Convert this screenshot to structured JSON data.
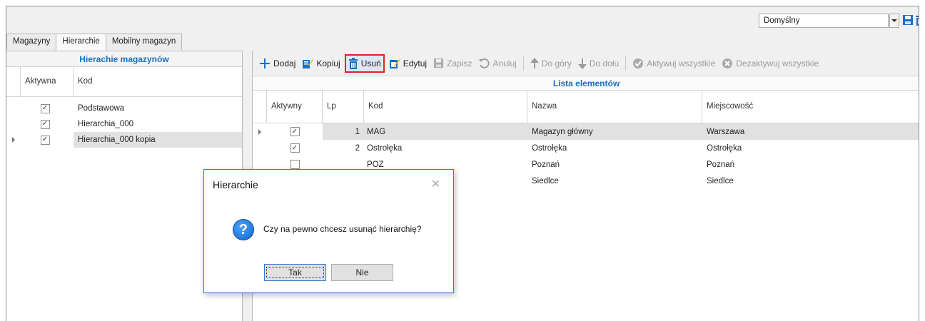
{
  "profile": {
    "selected": "Domyślny"
  },
  "tabs": [
    {
      "label": "Magazyny"
    },
    {
      "label": "Hierarchie"
    },
    {
      "label": "Mobilny magazyn"
    }
  ],
  "left_panel": {
    "title": "Hierachie magazynów",
    "columns": [
      "Aktywna",
      "Kod"
    ],
    "rows": [
      {
        "active": "✓",
        "code": "Podstawowa"
      },
      {
        "active": "✓",
        "code": "Hierarchia_000"
      },
      {
        "active": "✓",
        "code": "Hierarchia_000 kopia"
      }
    ]
  },
  "toolbar": {
    "add": "Dodaj",
    "copy": "Kopiuj",
    "delete": "Usuń",
    "edit": "Edytuj",
    "save": "Zapisz",
    "cancel": "Anuluj",
    "up": "Do góry",
    "down": "Do dołu",
    "activate_all": "Aktywuj wszystkie",
    "deactivate_all": "Dezaktywuj wszystkie"
  },
  "list": {
    "title": "Lista elementów",
    "columns": [
      "Aktywny",
      "Lp",
      "Kod",
      "Nazwa",
      "Miejscowość"
    ],
    "rows": [
      {
        "active": "✓",
        "lp": "1",
        "code": "MAG",
        "name": "Magazyn główny",
        "city": "Warszawa"
      },
      {
        "active": "✓",
        "lp": "2",
        "code": "Ostrołęka",
        "name": "Ostrołęka",
        "city": "Ostrołęka"
      },
      {
        "active": "",
        "lp": "",
        "code": "POZ",
        "name": "Poznań",
        "city": "Poznań"
      },
      {
        "active": "",
        "lp": "",
        "code": "",
        "name": "Siedlce",
        "city": "Siedlce"
      }
    ]
  },
  "dialog": {
    "title": "Hierarchie",
    "close": "✕",
    "message": "Czy na pewno chcesz usunąć hierarchię?",
    "yes": "Tak",
    "no": "Nie",
    "icon": "?"
  },
  "colors": {
    "accent": "#1d6fbf",
    "highlight_border": "#e0202a",
    "dialog_border": "#2d7dd2"
  }
}
